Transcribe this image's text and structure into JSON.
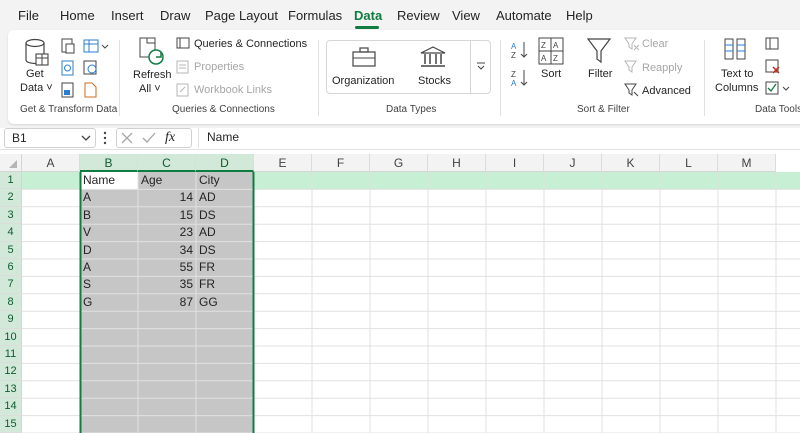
{
  "menu": {
    "items": [
      "File",
      "Home",
      "Insert",
      "Draw",
      "Page Layout",
      "Formulas",
      "Data",
      "Review",
      "View",
      "Automate",
      "Help"
    ],
    "active": "Data"
  },
  "ribbon": {
    "get_data": "Get",
    "get_data_2": "Data ˅",
    "refresh_all": "Refresh",
    "refresh_all_2": "All ˅",
    "queries_connections": "Queries & Connections",
    "properties": "Properties",
    "workbook_links": "Workbook Links",
    "organization": "Organization",
    "stocks": "Stocks",
    "sort": "Sort",
    "filter": "Filter",
    "clear": "Clear",
    "reapply": "Reapply",
    "advanced": "Advanced",
    "text_to_columns": "Text to",
    "text_to_columns_2": "Columns",
    "groups": {
      "get_transform": "Get & Transform Data",
      "queries": "Queries & Connections",
      "data_types": "Data Types",
      "sort_filter": "Sort & Filter",
      "data_tools": "Data Tools"
    }
  },
  "formula_bar": {
    "name_box": "B1",
    "fx": "fx",
    "content": "Name"
  },
  "grid": {
    "columns": [
      "A",
      "B",
      "C",
      "D",
      "E",
      "F",
      "G",
      "H",
      "I",
      "J",
      "K",
      "L",
      "M"
    ],
    "rows": [
      "1",
      "2",
      "3",
      "4",
      "5",
      "6",
      "7",
      "8",
      "9",
      "10",
      "11",
      "12",
      "13",
      "14",
      "15"
    ],
    "header": [
      "Name",
      "Age",
      "City"
    ],
    "data": [
      [
        "A",
        "14",
        "AD"
      ],
      [
        "B",
        "15",
        "DS"
      ],
      [
        "V",
        "23",
        "AD"
      ],
      [
        "D",
        "34",
        "DS"
      ],
      [
        "A",
        "55",
        "FR"
      ],
      [
        "S",
        "35",
        "FR"
      ],
      [
        "G",
        "87",
        "GG"
      ]
    ]
  },
  "colors": {
    "accent": "#107c41",
    "selection_fill": "#c6c6c6",
    "header_selected": "#d2e8d8"
  }
}
